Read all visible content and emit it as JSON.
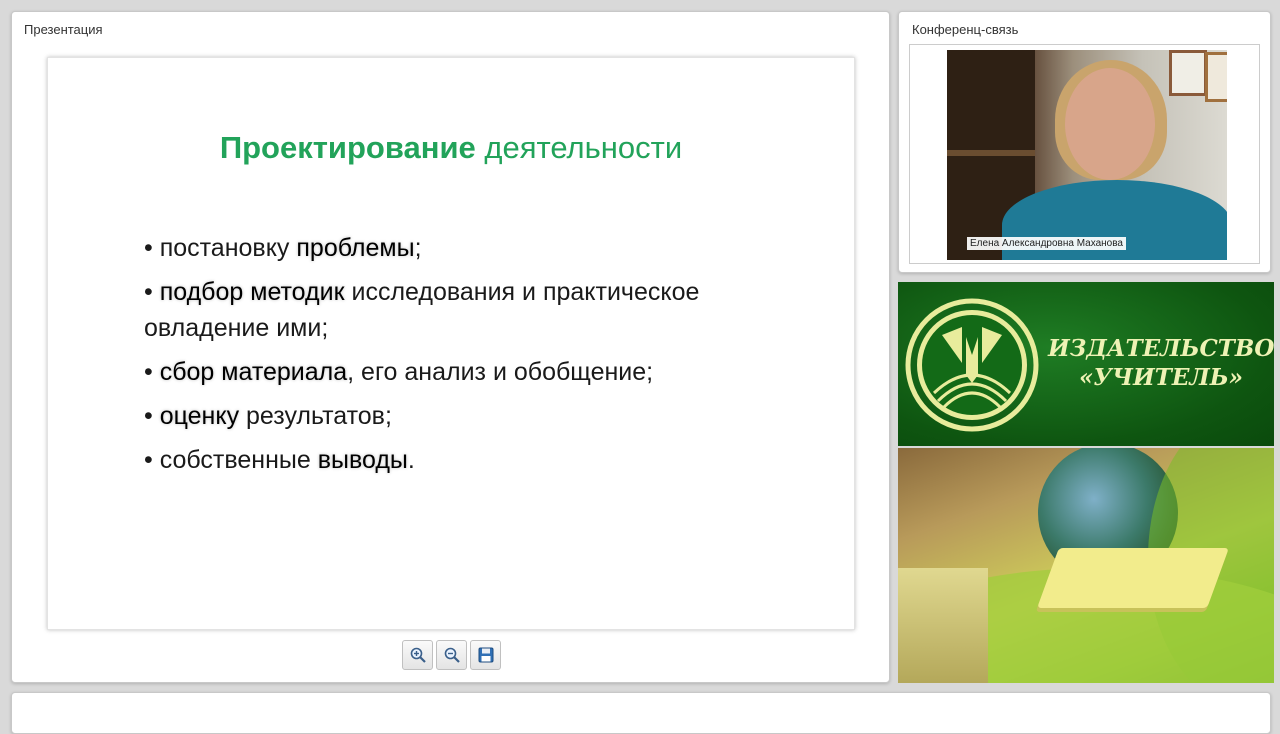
{
  "presentation": {
    "panel_title": "Презентация",
    "slide": {
      "title_bold": "Проектирование",
      "title_rest": " деятельности",
      "bullets": [
        {
          "prefix": "• постановку ",
          "highlight": "проблемы",
          "suffix": ";"
        },
        {
          "prefix": "• ",
          "highlight": "подбор методик",
          "suffix": " исследования и практическое овладение ими;"
        },
        {
          "prefix": "• ",
          "highlight": "сбор материала",
          "suffix": ", его анализ и обобщение;"
        },
        {
          "prefix": "• ",
          "highlight": "оценку",
          "suffix": " результатов;"
        },
        {
          "prefix": "• собственные ",
          "highlight": "выводы",
          "suffix": "."
        }
      ]
    },
    "toolbar": {
      "zoom_in_icon": "zoom-in-icon",
      "zoom_out_icon": "zoom-out-icon",
      "save_icon": "floppy-disk-icon"
    }
  },
  "conference": {
    "panel_title": "Конференц-связь",
    "caller_name": "Елена Александровна Маханова"
  },
  "publisher": {
    "name_line1": "ИЗДАТЕЛЬСТВО",
    "name_line2": "«УЧИТЕЛЬ»"
  },
  "colors": {
    "slide_title_green": "#22a35a",
    "banner_green": "#0e5510",
    "banner_text": "#eef2b4"
  }
}
